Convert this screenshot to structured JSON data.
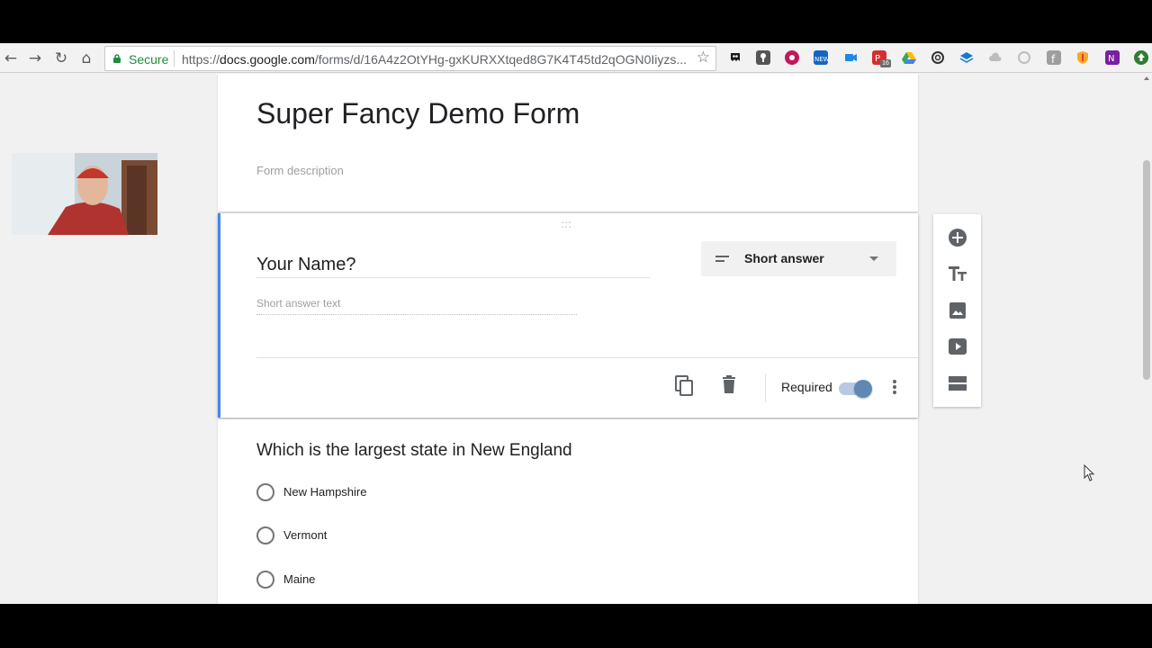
{
  "browser": {
    "secure_label": "Secure",
    "url_prefix": "https://",
    "url_host": "docs.google.com",
    "url_path": "/forms/d/16A4z2OtYHg-gxKURXXtqed8G7K4T45td2qOGN0Iiyzs...",
    "extension_badge": "16"
  },
  "form": {
    "title": "Super Fancy Demo Form",
    "description_placeholder": "Form description"
  },
  "question1": {
    "title": "Your Name?",
    "type_label": "Short answer",
    "answer_placeholder": "Short answer text",
    "required_label": "Required",
    "required_on": true
  },
  "question2": {
    "title": "Which is the largest state in New England",
    "options": [
      "New Hampshire",
      "Vermont",
      "Maine"
    ]
  },
  "colors": {
    "accent": "#4285f4",
    "toggle_knob": "#5f88b4",
    "secure_green": "#1e8e3e"
  }
}
